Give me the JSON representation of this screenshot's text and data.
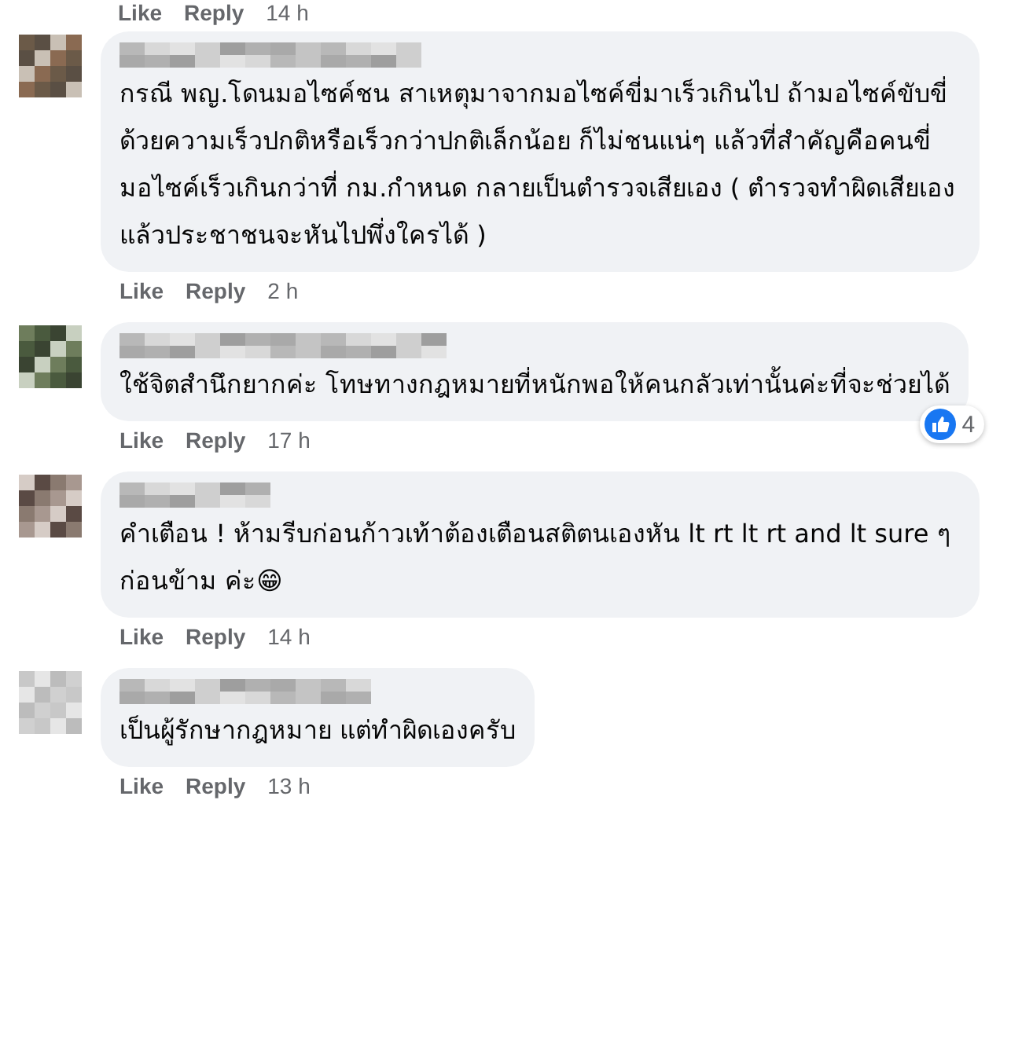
{
  "previous_actions": {
    "like": "Like",
    "reply": "Reply",
    "time": "14 h"
  },
  "comments": [
    {
      "text": "กรณี พญ.โดนมอไซค์ชน สาเหตุมาจากมอไซค์ขี่มาเร็วเกินไป ถ้ามอไซค์ขับขี่ด้วยความเร็วปกติหรือเร็วกว่าปกติเล็กน้อย ก็ไม่ชนแน่ๆ แล้วที่สำคัญคือคนขี่มอไซค์เร็วเกินกว่าที่ กม.กำหนด กลายเป็นตำรวจเสียเอง ( ตำรวจทำผิดเสียเอง แล้วประชาชนจะหันไปพึ่งใครได้ )",
      "like": "Like",
      "reply": "Reply",
      "time": "2 h"
    },
    {
      "text": "ใช้จิตสำนึกยากค่ะ โทษทางกฎหมายที่หนักพอให้คนกลัวเท่านั้นค่ะที่จะช่วยได้",
      "like": "Like",
      "reply": "Reply",
      "time": "17 h",
      "reactions": "4"
    },
    {
      "text": "คำเตือน ! ห้ามรีบก่อนก้าวเท้าต้องเตือนสติตนเองหัน lt rt lt rt and lt sure ๆ ก่อนข้าม ค่ะ😁",
      "like": "Like",
      "reply": "Reply",
      "time": "14 h"
    },
    {
      "text": "เป็นผู้รักษากฎหมาย แต่ทำผิดเองครับ",
      "like": "Like",
      "reply": "Reply",
      "time": "13 h"
    }
  ]
}
